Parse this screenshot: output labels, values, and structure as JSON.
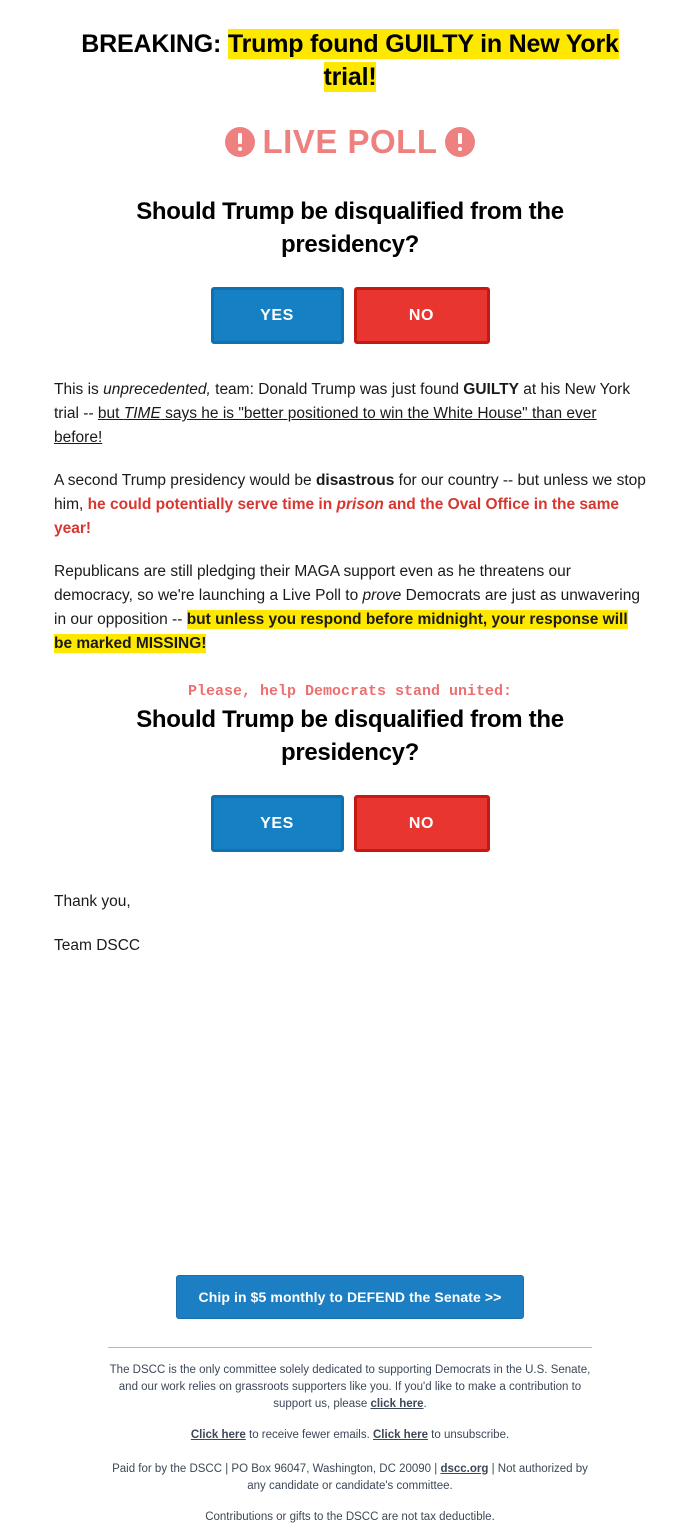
{
  "breaking": {
    "prefix": "BREAKING: ",
    "highlight": "Trump found GUILTY in New York trial!"
  },
  "live_poll": {
    "label": "LIVE POLL",
    "icon_left": "exclamation-circle-icon",
    "icon_right": "exclamation-circle-icon",
    "color": "#ef8080"
  },
  "poll": {
    "question": "Should Trump be disqualified from the presidency?",
    "yes_label": "YES",
    "no_label": "NO",
    "yes_color": "#1580c4",
    "no_color": "#e8352f"
  },
  "paragraphs": {
    "p1": {
      "a": "This is ",
      "b_italic": "unprecedented,",
      "c": " team: Donald Trump was just found ",
      "d_bold": "GUILTY",
      "e": " at his New York trial -- ",
      "f_link_a": "but ",
      "f_link_italic": "TIME",
      "f_link_b": " says he is \"better positioned to win the White House\" than ever before!"
    },
    "p2": {
      "a": "A second Trump presidency would be ",
      "b_bold": "disastrous",
      "c": " for our country -- but unless we stop him, ",
      "d_red_a": "he could potentially serve time in ",
      "d_red_italic": "prison",
      "d_red_b": " and the Oval Office in the same year!"
    },
    "p3": {
      "a": "Republicans are still pledging their MAGA support even as he threatens our democracy, so we're launching a Live Poll to ",
      "b_italic": "prove",
      "c": " Democrats are just as unwavering in our opposition -- ",
      "d_highlight": "but unless you respond before midnight, your response will be marked MISSING!"
    }
  },
  "plea": "Please, help Democrats stand united:",
  "signoff": {
    "line1": "Thank you,",
    "line2": "Team DSCC"
  },
  "donate": {
    "label": "Chip in $5 monthly to DEFEND the Senate >>",
    "color": "#1d7fc3"
  },
  "footer": {
    "about_a": "The DSCC is the only committee solely dedicated to supporting Democrats in the U.S. Senate, and our work relies on grassroots supporters like you. If you'd like to make a contribution to support us, please ",
    "about_link": "click here",
    "about_b": ".",
    "prefs_link1": "Click here",
    "prefs_mid": " to receive fewer emails. ",
    "prefs_link2": "Click here",
    "prefs_end": " to unsubscribe.",
    "paid_a": "Paid for by the DSCC | PO Box 96047, Washington, DC 20090 | ",
    "paid_link": "dscc.org",
    "paid_b": " | Not authorized by any candidate or candidate's committee.",
    "tax": "Contributions or gifts to the DSCC are not tax deductible."
  }
}
